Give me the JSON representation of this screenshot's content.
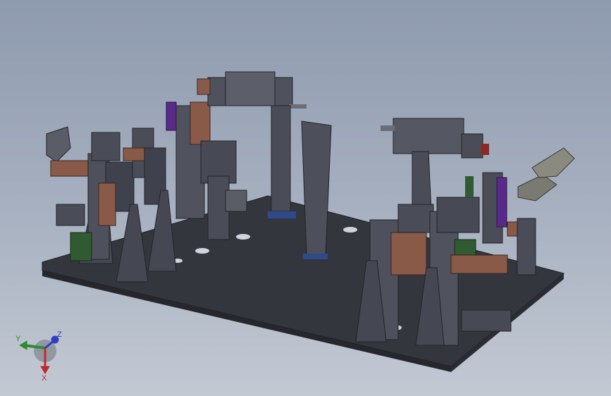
{
  "triad": {
    "x_label": "X",
    "y_label": "Y",
    "z_label": "Z",
    "x_color": "#c0282d",
    "y_color": "#2e8b2e",
    "z_color": "#2f3fbf"
  },
  "scene": {
    "background_top": "#8e9aae",
    "background_bottom": "#c3c9d3",
    "base_plate_color": "#3a3c44",
    "part_colors": {
      "steel": "#4a4d57",
      "copper": "#8a5a48",
      "purple": "#5a2a8a",
      "green": "#2f5a32",
      "grey": "#7a7a72"
    }
  }
}
